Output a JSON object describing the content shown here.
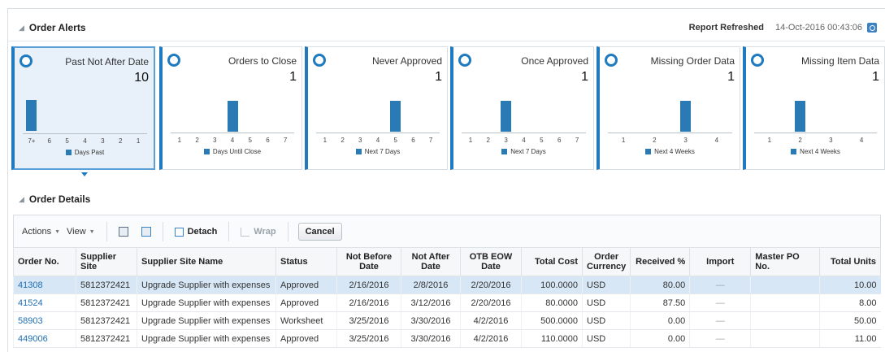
{
  "alerts": {
    "title": "Order Alerts",
    "refresh_label": "Report Refreshed",
    "refresh_value": "14-Oct-2016 00:43:06",
    "cards": [
      {
        "title": "Past Not After Date",
        "value": "10",
        "ticks": [
          "7+",
          "6",
          "5",
          "4",
          "3",
          "2",
          "1"
        ],
        "legend": "Days Past",
        "bar_index": 0
      },
      {
        "title": "Orders to Close",
        "value": "1",
        "ticks": [
          "1",
          "2",
          "3",
          "4",
          "5",
          "6",
          "7"
        ],
        "legend": "Days Until Close",
        "bar_index": 3
      },
      {
        "title": "Never Approved",
        "value": "1",
        "ticks": [
          "1",
          "2",
          "3",
          "4",
          "5",
          "6",
          "7"
        ],
        "legend": "Next 7 Days",
        "bar_index": 4
      },
      {
        "title": "Once Approved",
        "value": "1",
        "ticks": [
          "1",
          "2",
          "3",
          "4",
          "5",
          "6",
          "7"
        ],
        "legend": "Next 7 Days",
        "bar_index": 2
      },
      {
        "title": "Missing Order Data",
        "value": "1",
        "ticks": [
          "1",
          "2",
          "3",
          "4"
        ],
        "legend": "Next 4 Weeks",
        "bar_index": 2
      },
      {
        "title": "Missing Item Data",
        "value": "1",
        "ticks": [
          "1",
          "2",
          "3",
          "4"
        ],
        "legend": "Next 4 Weeks",
        "bar_index": 1
      }
    ]
  },
  "details": {
    "title": "Order Details",
    "toolbar": {
      "actions": "Actions",
      "view": "View",
      "detach": "Detach",
      "wrap": "Wrap",
      "cancel": "Cancel"
    },
    "columns": [
      "Order No.",
      "Supplier Site",
      "Supplier Site Name",
      "Status",
      "Not Before Date",
      "Not After Date",
      "OTB EOW Date",
      "Total Cost",
      "Order Currency",
      "Received %",
      "Import",
      "Master PO No.",
      "Total Units"
    ],
    "rows": [
      {
        "order": "41308",
        "site": "5812372421",
        "name": "Upgrade Supplier with expenses",
        "status": "Approved",
        "nbd": "2/16/2016",
        "nad": "2/8/2016",
        "otb": "2/20/2016",
        "cost": "100.0000",
        "cur": "USD",
        "recv": "80.00",
        "import": "—",
        "master": "",
        "units": "10.00"
      },
      {
        "order": "41524",
        "site": "5812372421",
        "name": "Upgrade Supplier with expenses",
        "status": "Approved",
        "nbd": "2/16/2016",
        "nad": "3/12/2016",
        "otb": "2/20/2016",
        "cost": "80.0000",
        "cur": "USD",
        "recv": "87.50",
        "import": "—",
        "master": "",
        "units": "8.00"
      },
      {
        "order": "58903",
        "site": "5812372421",
        "name": "Upgrade Supplier with expenses",
        "status": "Worksheet",
        "nbd": "3/25/2016",
        "nad": "3/30/2016",
        "otb": "4/2/2016",
        "cost": "500.0000",
        "cur": "USD",
        "recv": "0.00",
        "import": "—",
        "master": "",
        "units": "50.00"
      },
      {
        "order": "449006",
        "site": "5812372421",
        "name": "Upgrade Supplier with expenses",
        "status": "Approved",
        "nbd": "3/25/2016",
        "nad": "3/30/2016",
        "otb": "4/2/2016",
        "cost": "110.0000",
        "cur": "USD",
        "recv": "0.00",
        "import": "—",
        "master": "",
        "units": "11.00"
      }
    ]
  }
}
